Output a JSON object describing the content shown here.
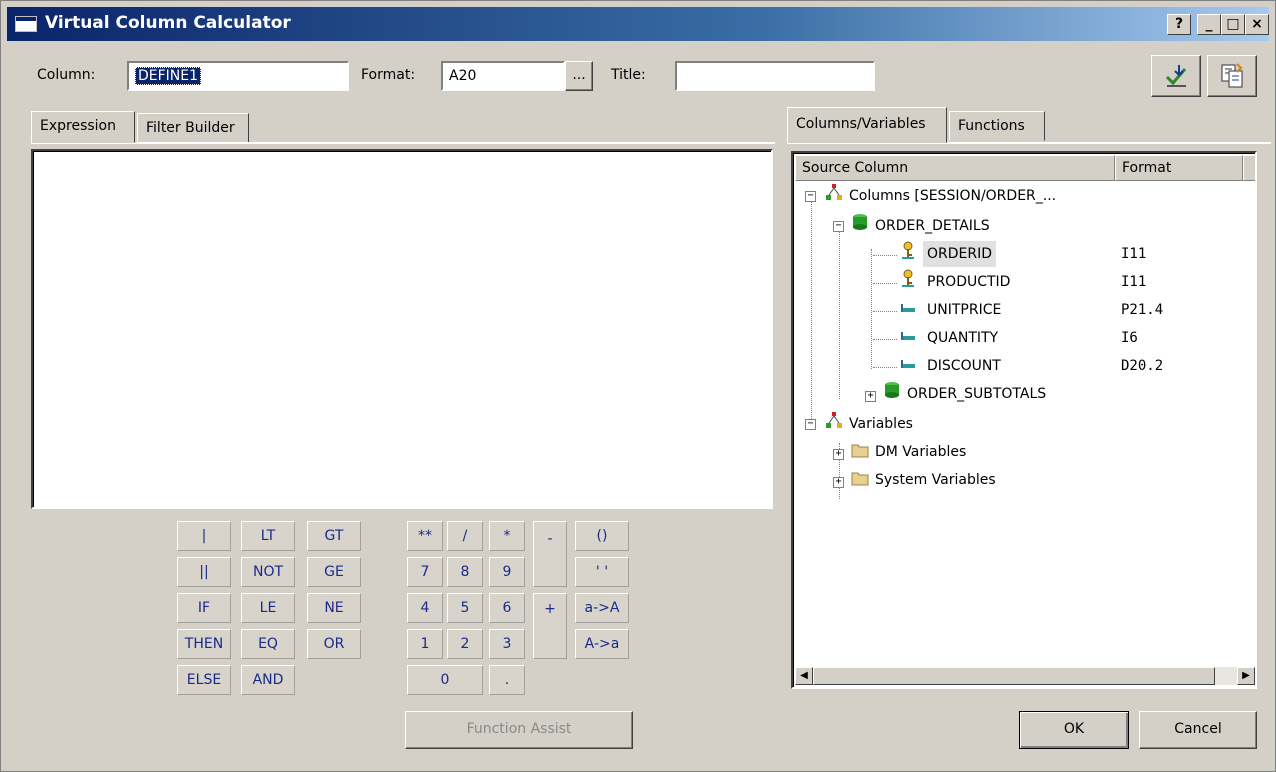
{
  "window": {
    "title": "Virtual Column Calculator",
    "titlebar_buttons": [
      "?",
      "_",
      "□",
      "×"
    ]
  },
  "top_fields": {
    "column_label": "Column:",
    "column_value": "DEFINE1",
    "format_label": "Format:",
    "format_value": "A20",
    "format_browse": "...",
    "title_label": "Title:",
    "title_value": ""
  },
  "left_tabs": [
    "Expression",
    "Filter Builder"
  ],
  "right_tabs": [
    "Columns/Variables",
    "Functions"
  ],
  "keypad": {
    "logic": [
      [
        "|",
        "LT",
        "GT"
      ],
      [
        "||",
        "NOT",
        "GE"
      ],
      [
        "IF",
        "LE",
        "NE"
      ],
      [
        "THEN",
        "EQ",
        "OR"
      ],
      [
        "ELSE",
        "AND"
      ]
    ],
    "numeric": [
      [
        "**",
        "/",
        "*"
      ],
      [
        "7",
        "8",
        "9"
      ],
      [
        "4",
        "5",
        "6"
      ],
      [
        "1",
        "2",
        "3"
      ]
    ],
    "minus": "-",
    "plus": "+",
    "zero": "0",
    "dot": ".",
    "misc": [
      "()",
      "' '",
      "a->A",
      "A->a"
    ]
  },
  "function_assist": "Function Assist",
  "tree": {
    "headers": [
      "Source Column",
      "Format"
    ],
    "root": "Columns [SESSION/ORDER_...",
    "table": "ORDER_DETAILS",
    "columns": [
      {
        "name": "ORDERID",
        "format": "I11",
        "key": true
      },
      {
        "name": "PRODUCTID",
        "format": "I11",
        "key": true
      },
      {
        "name": "UNITPRICE",
        "format": "P21.4",
        "key": false
      },
      {
        "name": "QUANTITY",
        "format": "I6",
        "key": false
      },
      {
        "name": "DISCOUNT",
        "format": "D20.2",
        "key": false
      }
    ],
    "subtotals": "ORDER_SUBTOTALS",
    "variables": "Variables",
    "dm_variables": "DM Variables",
    "system_variables": "System Variables"
  },
  "buttons": {
    "ok": "OK",
    "cancel": "Cancel"
  }
}
